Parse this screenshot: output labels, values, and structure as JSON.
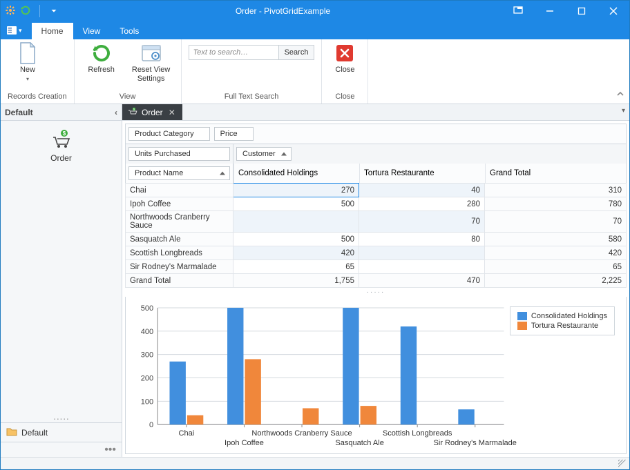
{
  "window": {
    "title": "Order - PivotGridExample"
  },
  "ribbon": {
    "tabs": [
      {
        "label": "Home",
        "active": true
      },
      {
        "label": "View",
        "active": false
      },
      {
        "label": "Tools",
        "active": false
      }
    ],
    "groups": {
      "records_creation": {
        "caption": "Records Creation",
        "new_label": "New"
      },
      "view": {
        "caption": "View",
        "refresh_label": "Refresh",
        "reset_view_label": "Reset View\nSettings"
      },
      "fulltext": {
        "caption": "Full Text Search",
        "placeholder": "Text to search…",
        "search_label": "Search"
      },
      "close": {
        "caption": "Close",
        "close_label": "Close"
      }
    }
  },
  "nav": {
    "header": "Default",
    "item_label": "Order",
    "footer_item": "Default"
  },
  "doc_tab": {
    "label": "Order"
  },
  "pivot": {
    "filter_fields": [
      "Product Category",
      "Price"
    ],
    "data_field": "Units Purchased",
    "column_field": "Customer",
    "row_field": "Product Name",
    "columns": [
      "Consolidated Holdings",
      "Tortura Restaurante",
      "Grand Total"
    ],
    "rows": [
      {
        "label": "Chai",
        "values": [
          "270",
          "40",
          "310"
        ],
        "focus_col": 0
      },
      {
        "label": "Ipoh Coffee",
        "values": [
          "500",
          "280",
          "780"
        ]
      },
      {
        "label": "Northwoods Cranberry Sauce",
        "values": [
          "",
          "70",
          "70"
        ]
      },
      {
        "label": "Sasquatch Ale",
        "values": [
          "500",
          "80",
          "580"
        ]
      },
      {
        "label": "Scottish Longbreads",
        "values": [
          "420",
          "",
          "420"
        ]
      },
      {
        "label": "Sir Rodney's Marmalade",
        "values": [
          "65",
          "",
          "65"
        ]
      }
    ],
    "grand_total": {
      "label": "Grand Total",
      "values": [
        "1,755",
        "470",
        "2,225"
      ]
    }
  },
  "chart_data": {
    "type": "bar",
    "categories": [
      "Chai",
      "Ipoh Coffee",
      "Northwoods Cranberry Sauce",
      "Sasquatch Ale",
      "Scottish Longbreads",
      "Sir Rodney's Marmalade"
    ],
    "series": [
      {
        "name": "Consolidated Holdings",
        "color": "#418fde",
        "values": [
          270,
          500,
          0,
          500,
          420,
          65
        ]
      },
      {
        "name": "Tortura Restaurante",
        "color": "#f0873b",
        "values": [
          40,
          280,
          70,
          80,
          0,
          0
        ]
      }
    ],
    "ylim": [
      0,
      500
    ],
    "yticks": [
      0,
      100,
      200,
      300,
      400,
      500
    ]
  }
}
